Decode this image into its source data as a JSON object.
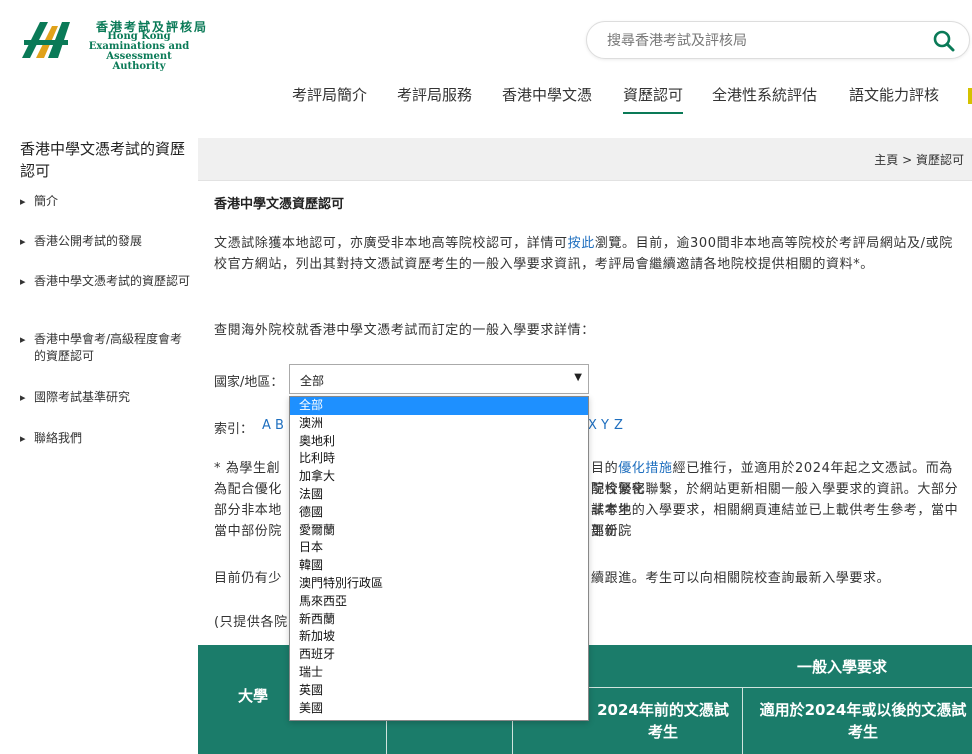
{
  "header": {
    "logo_zh": "香港考試及評核局",
    "logo_en": [
      "Hong Kong",
      "Examinations and",
      "Assessment Authority"
    ],
    "search_placeholder": "搜尋香港考試及評核局"
  },
  "nav": {
    "items": [
      "考評局簡介",
      "考評局服務",
      "香港中學文憑",
      "資歷認可",
      "全港性系統評估",
      "語文能力評核"
    ],
    "active": "資歷認可"
  },
  "sidebar": {
    "title": "香港中學文憑考試的資歷認可",
    "items": [
      "簡介",
      "香港公開考試的發展",
      "香港中學文憑考試的資歷認可",
      "香港中學會考/高級程度會考的資歷認可",
      "國際考試基準研究",
      "聯絡我們"
    ]
  },
  "breadcrumb": {
    "home": "主頁",
    "sep": ">",
    "current": "資歷認可"
  },
  "main": {
    "title": "香港中學文憑資歷認可",
    "para1_pre": "文憑試除獲本地認可，亦廣受非本地高等院校認可，詳情可",
    "para1_link": "按此",
    "para1_post": "瀏覽。目前，逾300間非本地高等院校於考評局網站及/或院校官方網站，列出其對持文憑試資歷考生的一般入學要求資訊，考評局會繼續邀請各地院校提供相關的資料*。",
    "para2": "查閱海外院校就香港中學文憑考試而訂定的一般入學要求詳情：",
    "country_label": "國家/地區：",
    "index_label": "索引：",
    "index_letters_left": [
      "A",
      "B"
    ],
    "index_letters_right": [
      "X",
      "Y",
      "Z"
    ],
    "note_pre": "* 為學生創",
    "note_mid": "目的",
    "note_link": "優化措施",
    "note_post": "經已推行，並適用於2024年起之文憑試。而為配合優化",
    "note_l3a": "院校緊密聯繫，於網站更新相關一般入學要求的資訊。大部分非本地",
    "note_l3b": "試考生的入學要求，相關網頁連結並已上載供考生參考，當中部份院",
    "note_l3c": "更新。",
    "para_current_pre": "目前仍有少",
    "para_current_post": "續跟進。考生可以向相關院校查詢最新入學要求。",
    "para_only": "(只提供各院"
  },
  "select": {
    "value": "全部",
    "options": [
      "全部",
      "澳洲",
      "奧地利",
      "比利時",
      "加拿大",
      "法國",
      "德國",
      "愛爾蘭",
      "日本",
      "韓國",
      "澳門特別行政區",
      "馬來西亞",
      "新西蘭",
      "新加坡",
      "西班牙",
      "瑞士",
      "英國",
      "美國"
    ]
  },
  "table": {
    "header_university": "大學",
    "header_general": "一般入學要求",
    "header_before2024": "2024年前的文憑試考生",
    "header_after2024": "適用於2024年或以後的文憑試考生"
  },
  "colors": {
    "brand_green": "#0a7a57",
    "table_green": "#1b7c6a",
    "link_blue": "#1f6fbf",
    "selected_option": "#1e90ff"
  }
}
